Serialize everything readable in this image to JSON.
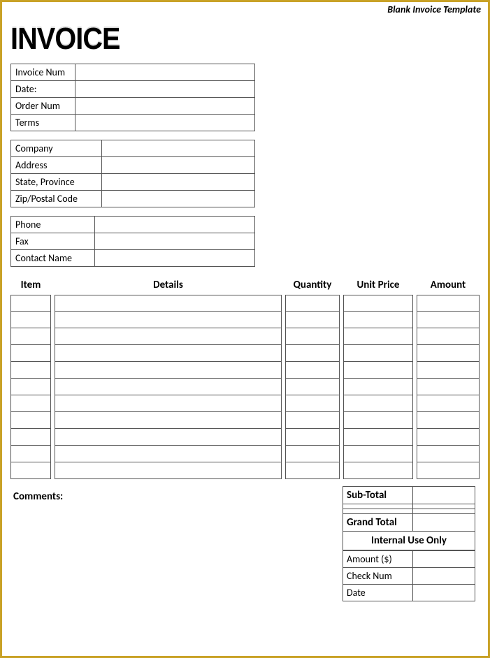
{
  "page_label": "Blank Invoice Template",
  "title": "INVOICE",
  "info1": {
    "invoice_num_label": "Invoice Num",
    "invoice_num": "",
    "date_label": "Date:",
    "date": "",
    "order_num_label": "Order Num",
    "order_num": "",
    "terms_label": "Terms",
    "terms": ""
  },
  "info2": {
    "company_label": "Company",
    "company": "",
    "address_label": "Address",
    "address": "",
    "state_label": "State, Province",
    "state": "",
    "zip_label": "Zip/Postal Code",
    "zip": ""
  },
  "info3": {
    "phone_label": "Phone",
    "phone": "",
    "fax_label": "Fax",
    "fax": "",
    "contact_label": "Contact Name",
    "contact": ""
  },
  "items_header": {
    "item": "Item",
    "details": "Details",
    "quantity": "Quantity",
    "unit_price": "Unit Price",
    "amount": "Amount"
  },
  "items": [
    {
      "item": "",
      "details": "",
      "qty": "",
      "price": "",
      "amount": ""
    },
    {
      "item": "",
      "details": "",
      "qty": "",
      "price": "",
      "amount": ""
    },
    {
      "item": "",
      "details": "",
      "qty": "",
      "price": "",
      "amount": ""
    },
    {
      "item": "",
      "details": "",
      "qty": "",
      "price": "",
      "amount": ""
    },
    {
      "item": "",
      "details": "",
      "qty": "",
      "price": "",
      "amount": ""
    },
    {
      "item": "",
      "details": "",
      "qty": "",
      "price": "",
      "amount": ""
    },
    {
      "item": "",
      "details": "",
      "qty": "",
      "price": "",
      "amount": ""
    },
    {
      "item": "",
      "details": "",
      "qty": "",
      "price": "",
      "amount": ""
    },
    {
      "item": "",
      "details": "",
      "qty": "",
      "price": "",
      "amount": ""
    },
    {
      "item": "",
      "details": "",
      "qty": "",
      "price": "",
      "amount": ""
    },
    {
      "item": "",
      "details": "",
      "qty": "",
      "price": "",
      "amount": ""
    }
  ],
  "comments_label": "Comments:",
  "totals": {
    "subtotal_label": "Sub-Total",
    "subtotal": "",
    "blank1": "",
    "blank2": "",
    "grand_total_label": "Grand Total",
    "grand_total": "",
    "internal_header": "Internal Use Only",
    "amount_label": "Amount ($)",
    "amount": "",
    "check_label": "Check Num",
    "check": "",
    "date_label": "Date",
    "date": ""
  }
}
